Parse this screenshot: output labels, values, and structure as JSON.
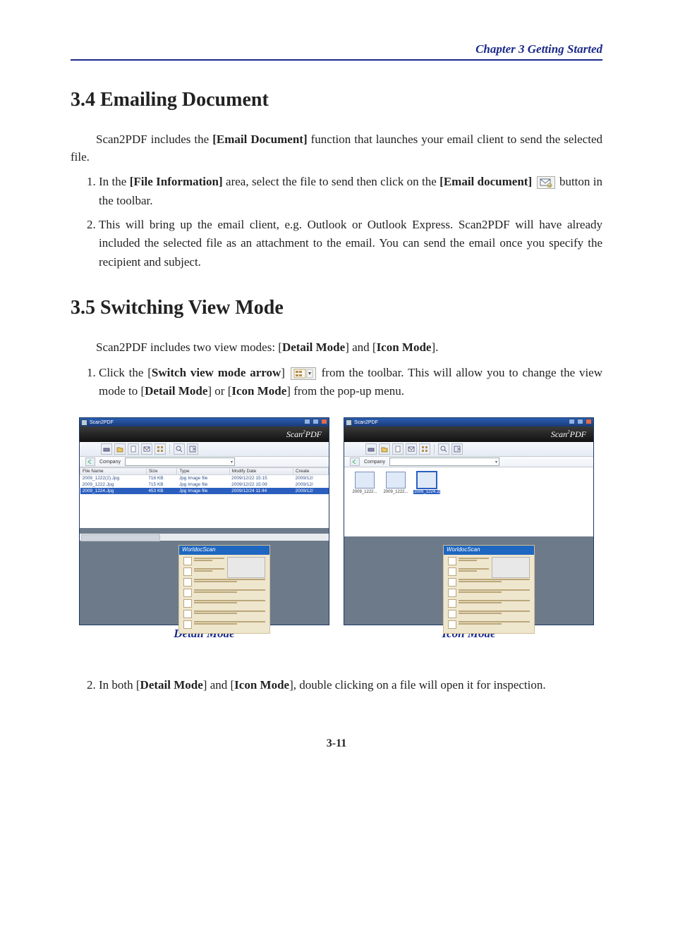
{
  "header": {
    "chapter": "Chapter 3  Getting Started"
  },
  "s34": {
    "title": "3.4 Emailing Document",
    "intro_pre": "Scan2PDF includes the ",
    "intro_bold": "[Email Document]",
    "intro_post": " function that launches your email client to send the selected file.",
    "li1_a": "In the ",
    "li1_b": "[File Information]",
    "li1_c": " area, select the file to send then click on the ",
    "li1_d": "[Email document]",
    "li1_e": " button in the toolbar.",
    "li2": "This will bring up the email client, e.g. Outlook or Outlook Express. Scan2PDF will have already included the selected file as an attachment to the email. You can send the email once you specify the recipient and subject."
  },
  "s35": {
    "title": "3.5 Switching View Mode",
    "intro_pre": "Scan2PDF includes two view modes: [",
    "intro_b1": "Detail Mode",
    "intro_mid": "] and [",
    "intro_b2": "Icon Mode",
    "intro_post": "].",
    "li1_a": "Click the [",
    "li1_b": "Switch view mode arrow",
    "li1_c": "] ",
    "li1_d": " from the toolbar. This will allow you to change the view mode to [",
    "li1_e": "Detail Mode",
    "li1_f": "] or [",
    "li1_g": "Icon Mode",
    "li1_h": "] from the pop-up menu.",
    "li2_a": "In both [",
    "li2_b": "Detail Mode",
    "li2_c": "] and [",
    "li2_d": "Icon Mode",
    "li2_e": "], double clicking on a file will open it for inspection."
  },
  "screens": {
    "caption_detail": "Detail Mode",
    "caption_icon": "Icon Mode",
    "app_title": "Scan2PDF",
    "brand_pre": "Scan",
    "brand_sup": "2",
    "brand_post": "PDF",
    "location_label": "Company",
    "doc_head": "WorldocScan",
    "detail": {
      "cols": [
        "File Name",
        "Size",
        "Type",
        "Modify Date",
        "Create"
      ],
      "rows": [
        {
          "name": "2009_1222(2).Jpg",
          "size": "716 KB",
          "type": "Jpg Image file",
          "mod": "2009/12/22 15:15",
          "cre": "2009/12/"
        },
        {
          "name": "2009_1222.Jpg",
          "size": "715 KB",
          "type": "Jpg Image file",
          "mod": "2009/12/22 15:09",
          "cre": "2009/12/"
        },
        {
          "name": "2009_1224.Jpg",
          "size": "453 KB",
          "type": "Jpg Image file",
          "mod": "2009/12/24 11:44",
          "cre": "2009/12/",
          "sel": true
        }
      ]
    },
    "icon": {
      "thumbs": [
        {
          "label": "2009_1222..."
        },
        {
          "label": "2009_1222..."
        },
        {
          "label": "2009_1224.Jp",
          "sel": true
        }
      ]
    }
  },
  "page_number": "3-11"
}
